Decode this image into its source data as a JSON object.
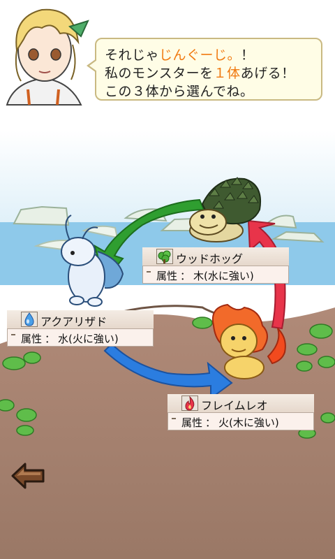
{
  "dialog": {
    "line1_a": "それじゃ",
    "line1_b": "じんぐーじ。",
    "line1_c": "！",
    "line2_a": "私のモンスターを",
    "line2_b": "１体",
    "line2_c": "あげる！",
    "line3": "この３体から選んでね。"
  },
  "monsters": [
    {
      "name": "ウッドホッグ",
      "attr_label": "属性",
      "colon": "：",
      "attr_value": "木(水に強い)",
      "icon": "leaf-icon"
    },
    {
      "name": "アクアリザド",
      "attr_label": "属性",
      "colon": "：",
      "attr_value": "水(火に強い)",
      "icon": "water-drop-icon"
    },
    {
      "name": "フレイムレオ",
      "attr_label": "属性",
      "colon": "：",
      "attr_value": "火(木に強い)",
      "icon": "flame-icon"
    }
  ],
  "controls": {
    "back_icon": "back-arrow-icon"
  },
  "colors": {
    "highlight": "#f07a10",
    "wood": "#2f9e30",
    "water": "#2b7de0",
    "fire": "#e8344a"
  }
}
